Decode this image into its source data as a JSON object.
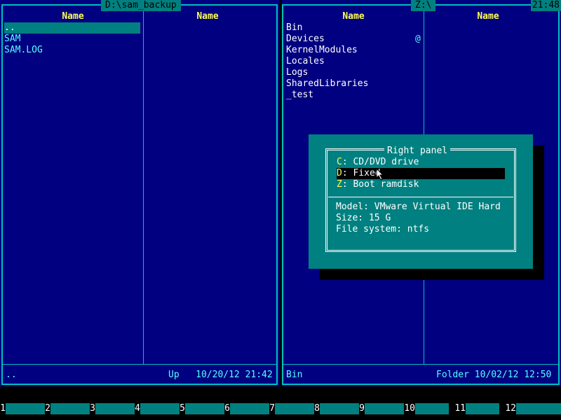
{
  "left_panel": {
    "path": "D:\\sam_backup",
    "col1_header": "Name",
    "col2_header": "Name",
    "files": [
      "..",
      "SAM",
      "SAM.LOG"
    ],
    "status_name": "..",
    "status_info": "Up   10/20/12 21:42"
  },
  "right_panel": {
    "path": "Z:\\",
    "col1_header": "Name",
    "col2_header": "Name",
    "files": [
      "Bin",
      "Devices",
      "KernelModules",
      "Locales",
      "Logs",
      "SharedLibraries",
      "_test"
    ],
    "mark": "@",
    "status_name": "Bin",
    "status_info": "Folder 10/02/12 12:50"
  },
  "clock": "21:48",
  "drive_dialog": {
    "title": "Right panel",
    "drives": [
      {
        "key": "C",
        "label": ": CD/DVD drive"
      },
      {
        "key": "D",
        "label": ": Fixed"
      },
      {
        "key": "Z",
        "label": ": Boot ramdisk"
      }
    ],
    "selected_index": 1,
    "info": {
      "model": "Model: VMware Virtual IDE Hard",
      "size": "Size: 15 G",
      "fs": "File system: ntfs"
    }
  },
  "fkeys": [
    "1",
    "2",
    "3",
    "4",
    "5",
    "6",
    "7",
    "8",
    "9",
    "10",
    "11",
    "12"
  ],
  "colors": {
    "panel_bg": "#000080",
    "accent": "#008080",
    "header": "#ffff55",
    "file": "#55ffff"
  }
}
